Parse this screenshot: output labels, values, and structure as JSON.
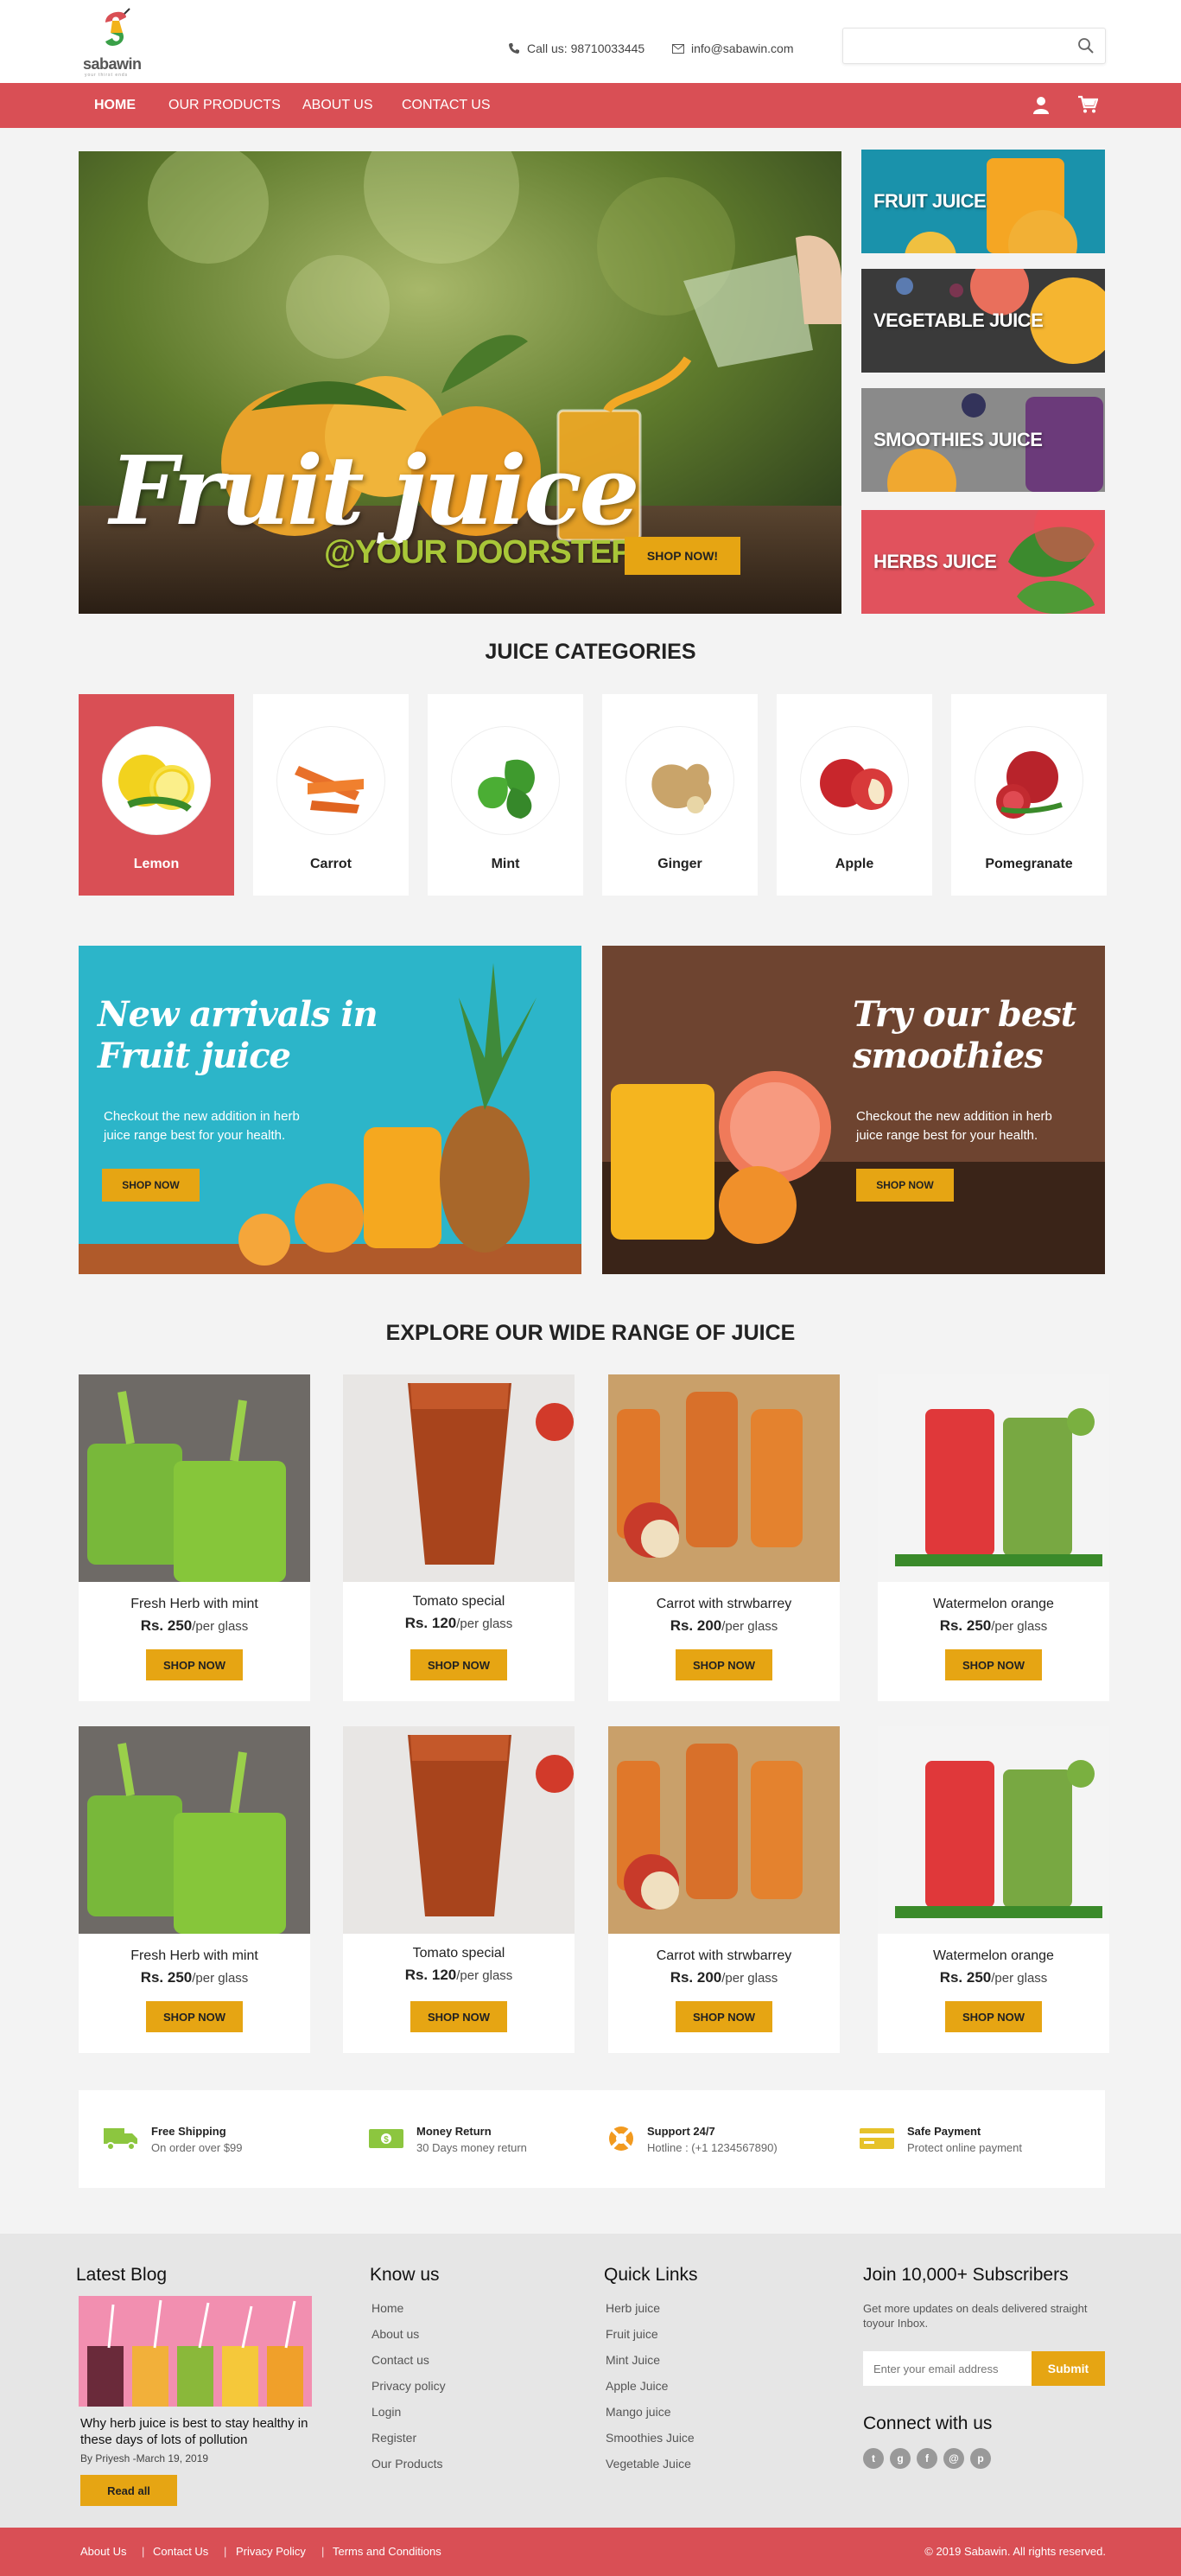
{
  "header": {
    "logo_name": "sabawin",
    "logo_tagline": "your thirst ends",
    "phone": "Call us: 98710033445",
    "email": "info@sabawin.com",
    "search_placeholder": ""
  },
  "nav": {
    "items": [
      "HOME",
      "OUR PRODUCTS",
      "ABOUT US",
      "CONTACT US"
    ],
    "active": "HOME"
  },
  "hero": {
    "title": "Fruit juice",
    "subtitle": "@YOUR DOORSTEP",
    "button": "SHOP NOW!"
  },
  "side_categories": [
    "FRUIT JUICE",
    "VEGETABLE JUICE",
    "SMOOTHIES JUICE",
    "HERBS JUICE"
  ],
  "categories_section": {
    "title": "JUICE CATEGORIES",
    "items": [
      "Lemon",
      "Carrot",
      "Mint",
      "Ginger",
      "Apple",
      "Pomegranate"
    ],
    "active": "Lemon"
  },
  "promos": [
    {
      "title_line1": "New arrivals in",
      "title_line2": "Fruit juice",
      "desc_line1": "Checkout the new addition in herb",
      "desc_line2": "juice range best for your health.",
      "button": "SHOP NOW"
    },
    {
      "title_line1": "Try our best",
      "title_line2": "smoothies",
      "desc_line1": "Checkout the new addition in herb",
      "desc_line2": "juice range best for your health.",
      "button": "SHOP NOW"
    }
  ],
  "products_section": {
    "title": "EXPLORE OUR WIDE RANGE OF JUICE",
    "items": [
      {
        "name": "Fresh Herb with mint",
        "price": "Rs. 250",
        "unit": "/per glass",
        "button": "SHOP NOW"
      },
      {
        "name": "Tomato special",
        "price": "Rs. 120",
        "unit": "/per glass",
        "button": "SHOP NOW"
      },
      {
        "name": "Carrot with strwbarrey",
        "price": "Rs. 200",
        "unit": "/per glass",
        "button": "SHOP NOW"
      },
      {
        "name": "Watermelon orange",
        "price": "Rs. 250",
        "unit": "/per glass",
        "button": "SHOP NOW"
      },
      {
        "name": "Fresh Herb with mint",
        "price": "Rs. 250",
        "unit": "/per glass",
        "button": "SHOP NOW"
      },
      {
        "name": "Tomato special",
        "price": "Rs. 120",
        "unit": "/per glass",
        "button": "SHOP NOW"
      },
      {
        "name": "Carrot with strwbarrey",
        "price": "Rs. 200",
        "unit": "/per glass",
        "button": "SHOP NOW"
      },
      {
        "name": "Watermelon orange",
        "price": "Rs. 250",
        "unit": "/per glass",
        "button": "SHOP NOW"
      }
    ]
  },
  "features": [
    {
      "title": "Free Shipping",
      "subtitle": "On order over $99",
      "icon": "truck-icon"
    },
    {
      "title": "Money Return",
      "subtitle": "30 Days money return",
      "icon": "money-icon"
    },
    {
      "title": "Support 24/7",
      "subtitle": "Hotline : (+1 1234567890)",
      "icon": "lifebuoy-icon"
    },
    {
      "title": "Safe Payment",
      "subtitle": "Protect online payment",
      "icon": "card-icon"
    }
  ],
  "footer": {
    "blog": {
      "title": "Latest Blog",
      "post_title": "Why herb juice is best to stay healthy in these days of lots of pollution",
      "meta": "By Priyesh -March 19, 2019",
      "button": "Read all"
    },
    "know_us": {
      "title": "Know us",
      "links": [
        "Home",
        "About us",
        "Contact us",
        "Privacy policy",
        "Login",
        "Register",
        "Our Products"
      ]
    },
    "quick_links": {
      "title": "Quick Links",
      "links": [
        "Herb juice",
        "Fruit juice",
        "Mint Juice",
        "Apple Juice",
        "Mango juice",
        "Smoothies Juice",
        "Vegetable Juice"
      ]
    },
    "subscribe": {
      "title": "Join 10,000+ Subscribers",
      "desc": "Get more updates on deals delivered straight  toyour Inbox.",
      "placeholder": "Enter your email address",
      "button": "Submit"
    },
    "connect_title": "Connect with us",
    "social_icons": [
      "twitter-icon",
      "google-plus-icon",
      "facebook-icon",
      "mail-icon",
      "pinterest-icon"
    ]
  },
  "bottom_bar": {
    "links": [
      "About Us",
      "Contact Us",
      "Privacy Policy",
      "Terms and Conditions"
    ],
    "copyright": "© 2019 Sabawin. All rights reserved."
  },
  "colors": {
    "brand_red": "#d94f55",
    "accent_yellow": "#e6a513",
    "lime": "#a8c638"
  }
}
